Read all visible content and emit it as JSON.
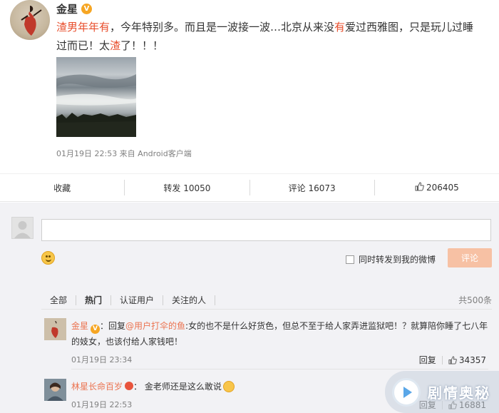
{
  "post": {
    "author": "金星",
    "verified_badge": "V",
    "text_highlight_1": "渣男年年有",
    "text_part_1": "，今年特别多。而且是一波接一波…北京从来没",
    "text_highlight_2": "有",
    "text_part_2": "爱过西雅图，只是玩儿过睡过而已！太",
    "text_highlight_3": "渣",
    "text_part_3": "了！！！",
    "meta": "01月19日 22:53 来自 Android客户端"
  },
  "actions": {
    "favorite_label": "收藏",
    "repost_label": "转发 10050",
    "comment_label": "评论 16073",
    "like_count": "206405"
  },
  "composer": {
    "input_placeholder": "",
    "repost_option_label": "同时转发到我的微博",
    "submit_label": "评论"
  },
  "filters": {
    "tabs": [
      "全部",
      "热门",
      "认证用户",
      "关注的人"
    ],
    "active_tab": "热门",
    "total": "共500条"
  },
  "comments": [
    {
      "user": "金星",
      "reply_prefix": "：回复",
      "mention": "@用户打伞的鱼",
      "text": ":女的也不是什么好货色，但总不至于给人家弄进监狱吧！？就算陪你睡了七八年的妓女，也该付给人家钱吧！",
      "time": "01月19日 23:34",
      "reply_label": "回复",
      "likes": "34357"
    },
    {
      "user": "林星长命百岁",
      "text": "：  金老师还是这么敢说",
      "time": "01月19日 22:53",
      "reply_label": "回复",
      "likes": "16881"
    }
  ],
  "watermark": {
    "text": "剧情奥秘"
  },
  "colors": {
    "accent": "#eb7350",
    "highlight": "#e84e2c",
    "button_disabled": "#f7c1a4",
    "panel_bg": "#f2f2f5"
  }
}
